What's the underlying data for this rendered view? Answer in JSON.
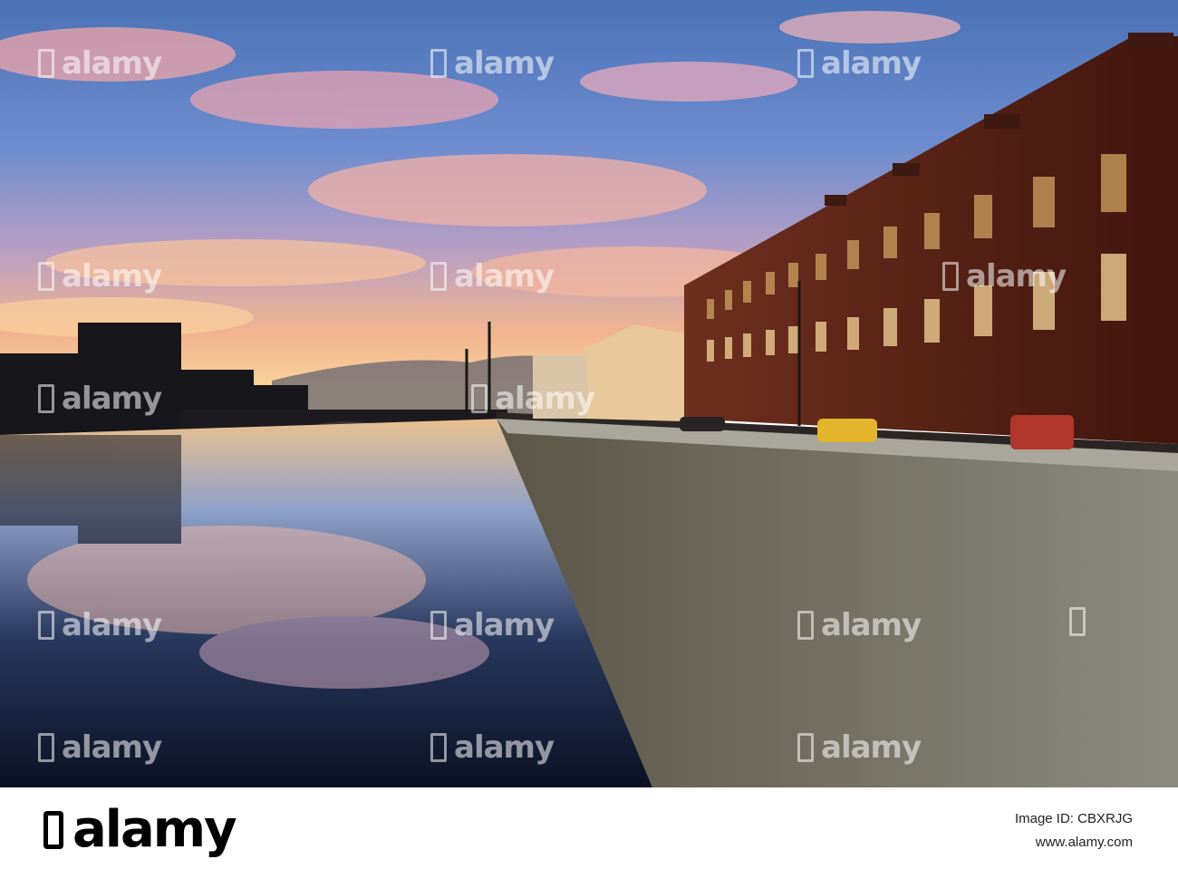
{
  "image": {
    "watermark_text": "alamy",
    "footer": {
      "logo_text": "alamy",
      "image_id_label": "Image ID: CBXRJG",
      "site": "www.alamy.com"
    }
  }
}
